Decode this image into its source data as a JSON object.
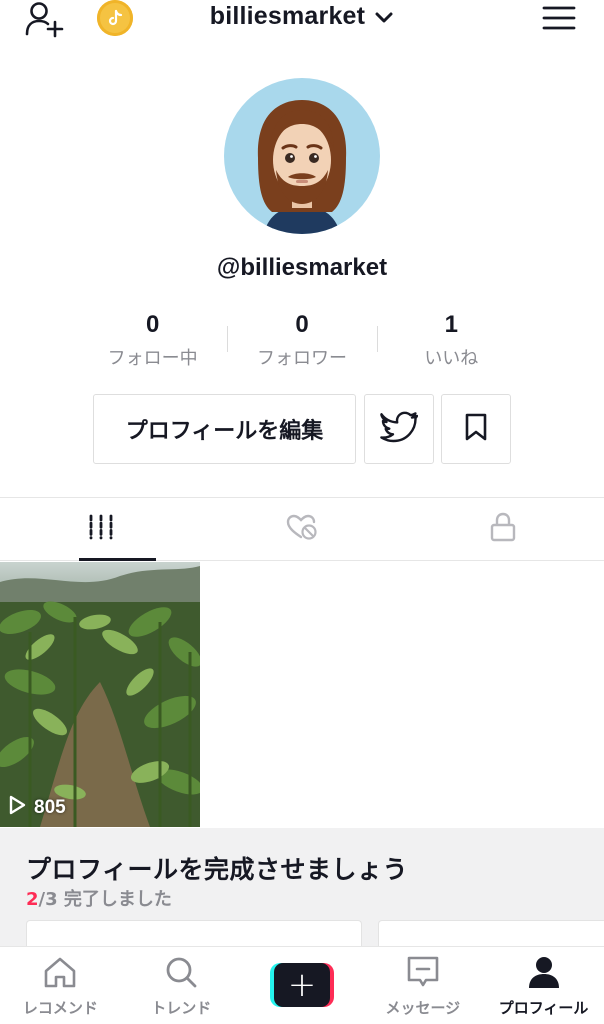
{
  "header": {
    "username": "billiesmarket",
    "icons": [
      "add-user-icon",
      "coin-icon",
      "chevron-down-icon",
      "menu-icon"
    ]
  },
  "profile": {
    "handle": "@billiesmarket",
    "stats": [
      {
        "value": "0",
        "label": "フォロー中"
      },
      {
        "value": "0",
        "label": "フォロワー"
      },
      {
        "value": "1",
        "label": "いいね"
      }
    ],
    "edit_button_label": "プロフィールを編集"
  },
  "tabs": [
    "videos-grid-icon",
    "liked-hidden-icon",
    "lock-icon"
  ],
  "videos": [
    {
      "views": "805"
    }
  ],
  "complete_profile": {
    "title": "プロフィールを完成させましょう",
    "progress_done": "2",
    "progress_total": "/3",
    "progress_text": " 完了しました"
  },
  "navbar": {
    "items": [
      {
        "label": "レコメンド",
        "icon": "home-icon"
      },
      {
        "label": "トレンド",
        "icon": "search-icon"
      },
      {
        "label": "+",
        "icon": "create-icon"
      },
      {
        "label": "メッセージ",
        "icon": "message-icon"
      },
      {
        "label": "プロフィール",
        "icon": "profile-icon"
      }
    ]
  },
  "colors": {
    "accent_red": "#fe2c55",
    "accent_cyan": "#25f4ee",
    "text_dark": "#161823",
    "text_grey": "#8a8b91"
  }
}
